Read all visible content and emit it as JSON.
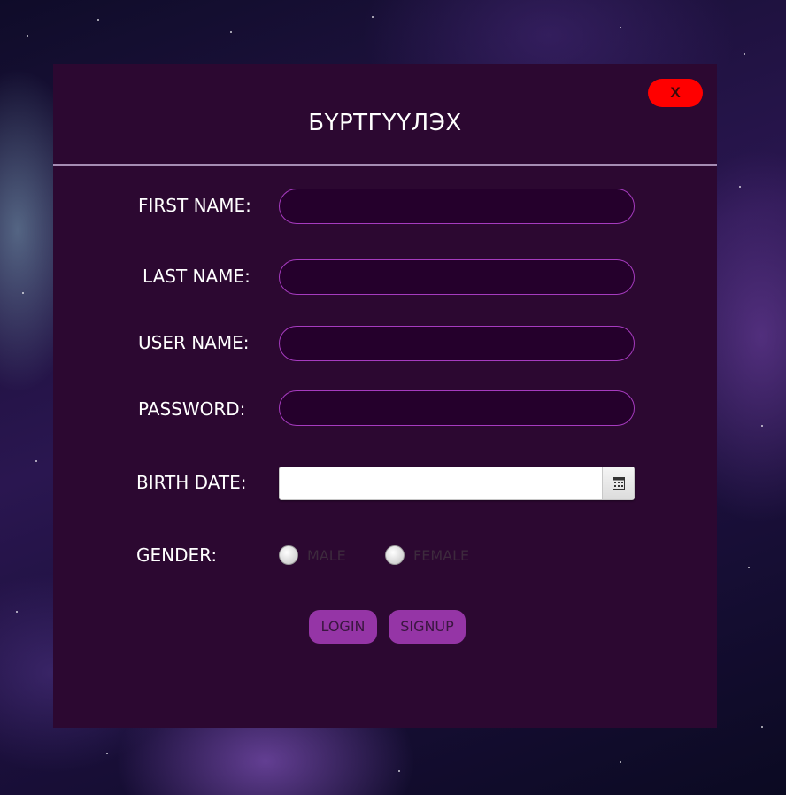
{
  "window": {
    "title": "БҮРТГҮҮЛЭХ",
    "close_label": "X"
  },
  "form": {
    "first_name": {
      "label": "FIRST NAME:",
      "value": ""
    },
    "last_name": {
      "label": "LAST NAME:",
      "value": ""
    },
    "user_name": {
      "label": "USER NAME:",
      "value": ""
    },
    "password": {
      "label": "PASSWORD:",
      "value": ""
    },
    "birth_date": {
      "label": "BIRTH DATE:",
      "value": ""
    },
    "gender": {
      "label": "GENDER:",
      "options": [
        "MALE",
        "FEMALE"
      ],
      "selected": null
    }
  },
  "actions": {
    "login_label": "LOGIN",
    "signup_label": "SIGNUP"
  },
  "icons": {
    "close": "close-icon",
    "calendar": "calendar-icon"
  },
  "colors": {
    "panel_background": "#2c0831",
    "field_border": "#a63bbf",
    "field_background": "#25002c",
    "button_background": "#9535a6",
    "close_button": "#ff0000"
  }
}
